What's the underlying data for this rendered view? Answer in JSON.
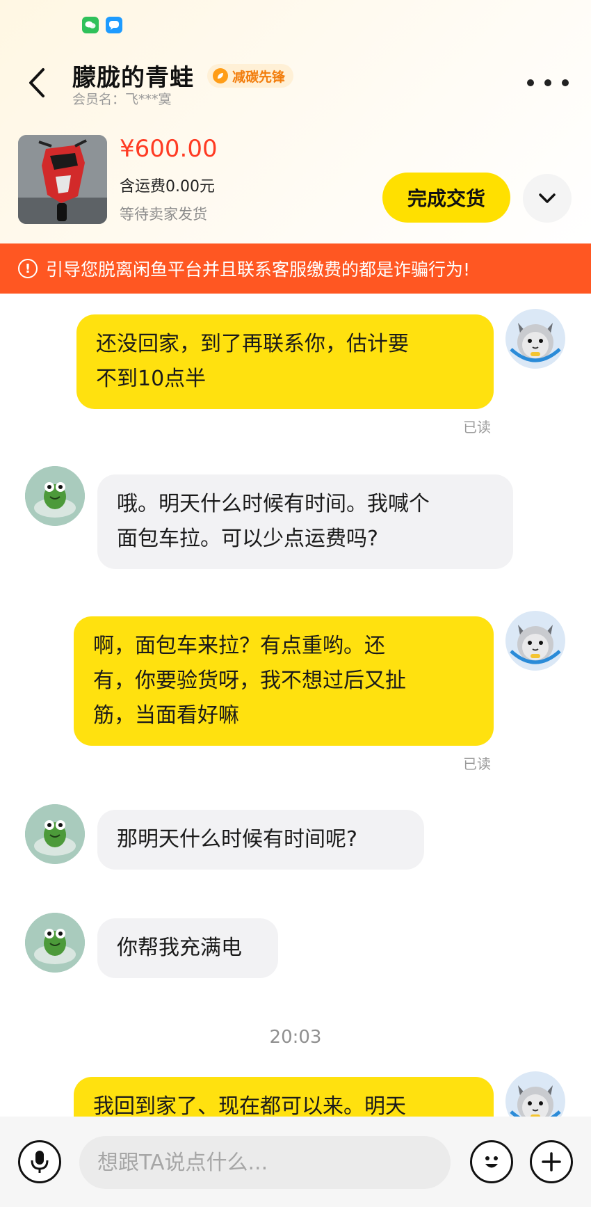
{
  "header": {
    "title": "朦胧的青蛙",
    "badge": "减碳先锋",
    "member": "会员名：飞***寞"
  },
  "product": {
    "price": "¥600.00",
    "shipping": "含运费0.00元",
    "status": "等待卖家发货",
    "action_label": "完成交货"
  },
  "warning": {
    "text": "引导您脱离闲鱼平台并且联系客服缴费的都是诈骗行为!"
  },
  "messages": [
    {
      "from": "me",
      "lines": [
        "还没回家，到了再联系你，估计要",
        "不到10点半"
      ],
      "read": "已读"
    },
    {
      "from": "other",
      "lines": [
        "哦。明天什么时候有时间。我喊个",
        "面包车拉。可以少点运费吗?"
      ]
    },
    {
      "from": "me",
      "lines": [
        "啊，面包车来拉？有点重哟。还",
        "有，你要验货呀，我不想过后又扯",
        "筋，当面看好嘛"
      ],
      "read": "已读"
    },
    {
      "from": "other",
      "lines": [
        "那明天什么时候有时间呢?"
      ]
    },
    {
      "from": "other",
      "lines": [
        "你帮我充满电"
      ]
    },
    {
      "from": "me",
      "lines": [
        "我回到家了、现在都可以来。明天"
      ]
    }
  ],
  "timestamp": "20:03",
  "input": {
    "placeholder": "想跟TA说点什么..."
  },
  "colors": {
    "accent_yellow": "#ffe10f",
    "warning_orange": "#ff5722",
    "price_red": "#ff3b23"
  },
  "icons": [
    "wechat-icon",
    "message-icon",
    "back-arrow-icon",
    "more-icon",
    "chevron-down-icon",
    "alert-circle-icon",
    "microphone-icon",
    "emoji-icon",
    "plus-icon"
  ]
}
